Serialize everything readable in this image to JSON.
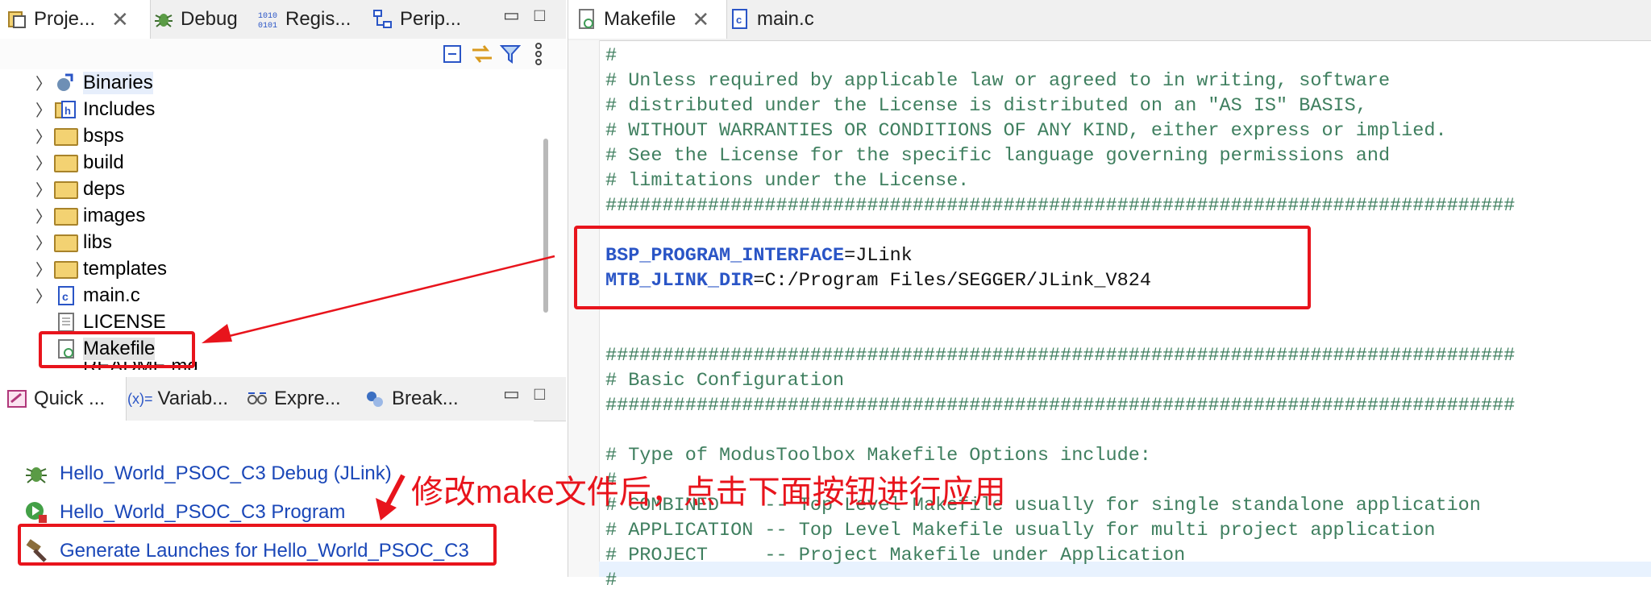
{
  "project_pane": {
    "tabs": [
      {
        "label": "Proje...",
        "icon": "project-icon"
      },
      {
        "label": "Debug",
        "icon": "bug-icon"
      },
      {
        "label": "Regis...",
        "icon": "registers-icon"
      },
      {
        "label": "Perip...",
        "icon": "peripherals-icon"
      }
    ],
    "tree": [
      {
        "label": "Binaries",
        "icon": "binaries-icon",
        "expandable": true
      },
      {
        "label": "Includes",
        "icon": "includes-icon",
        "expandable": true
      },
      {
        "label": "bsps",
        "icon": "folder-icon",
        "expandable": true
      },
      {
        "label": "build",
        "icon": "folder-icon",
        "expandable": true
      },
      {
        "label": "deps",
        "icon": "folder-icon",
        "expandable": true
      },
      {
        "label": "images",
        "icon": "folder-icon",
        "expandable": true
      },
      {
        "label": "libs",
        "icon": "folder-icon",
        "expandable": true
      },
      {
        "label": "templates",
        "icon": "folder-icon",
        "expandable": true
      },
      {
        "label": "main.c",
        "icon": "c-file-icon",
        "expandable": true
      },
      {
        "label": "LICENSE",
        "icon": "text-file-icon",
        "expandable": false
      },
      {
        "label": "Makefile",
        "icon": "makefile-icon",
        "expandable": false,
        "selected": true
      },
      {
        "label": "README.md",
        "icon": "text-file-icon",
        "expandable": false
      }
    ]
  },
  "quick_pane": {
    "tabs": [
      {
        "label": "Quick ...",
        "icon": "quick-panel-icon"
      },
      {
        "label": "Variab...",
        "icon": "variables-icon",
        "prefix": "(x)="
      },
      {
        "label": "Expre...",
        "icon": "expressions-icon"
      },
      {
        "label": "Break...",
        "icon": "breakpoints-icon"
      }
    ],
    "launches": [
      {
        "label": "Hello_World_PSOC_C3 Debug (JLink)",
        "icon": "bug-icon"
      },
      {
        "label": "Hello_World_PSOC_C3 Program",
        "icon": "program-icon"
      },
      {
        "label": "Generate Launches for Hello_World_PSOC_C3",
        "icon": "hammer-icon"
      }
    ]
  },
  "editor": {
    "tabs": [
      {
        "label": "Makefile",
        "icon": "makefile-icon",
        "active": true
      },
      {
        "label": "main.c",
        "icon": "c-file-icon",
        "active": false
      }
    ],
    "lines": [
      "#",
      "# Unless required by applicable law or agreed to in writing, software",
      "# distributed under the License is distributed on an \"AS IS\" BASIS,",
      "# WITHOUT WARRANTIES OR CONDITIONS OF ANY KIND, either express or implied.",
      "# See the License for the specific language governing permissions and",
      "# limitations under the License.",
      "################################################################################",
      "",
      {
        "var": "BSP_PROGRAM_INTERFACE",
        "value": "=JLink"
      },
      {
        "var": "MTB_JLINK_DIR",
        "value": "=C:/Program Files/SEGGER/JLink_V824"
      },
      "",
      "",
      "################################################################################",
      "# Basic Configuration",
      "################################################################################",
      "",
      "# Type of ModusToolbox Makefile Options include:",
      "#",
      "# COMBINED    -- Top Level Makefile usually for single standalone application",
      "# APPLICATION -- Top Level Makefile usually for multi project application",
      "# PROJECT     -- Project Makefile under Application",
      "#"
    ]
  },
  "annotation": "修改make文件后，点击下面按钮进行应用",
  "colors": {
    "highlight": "#e8141c",
    "comment": "#3f7f5f",
    "variable": "#2a55c6",
    "link": "#1a47b8"
  }
}
